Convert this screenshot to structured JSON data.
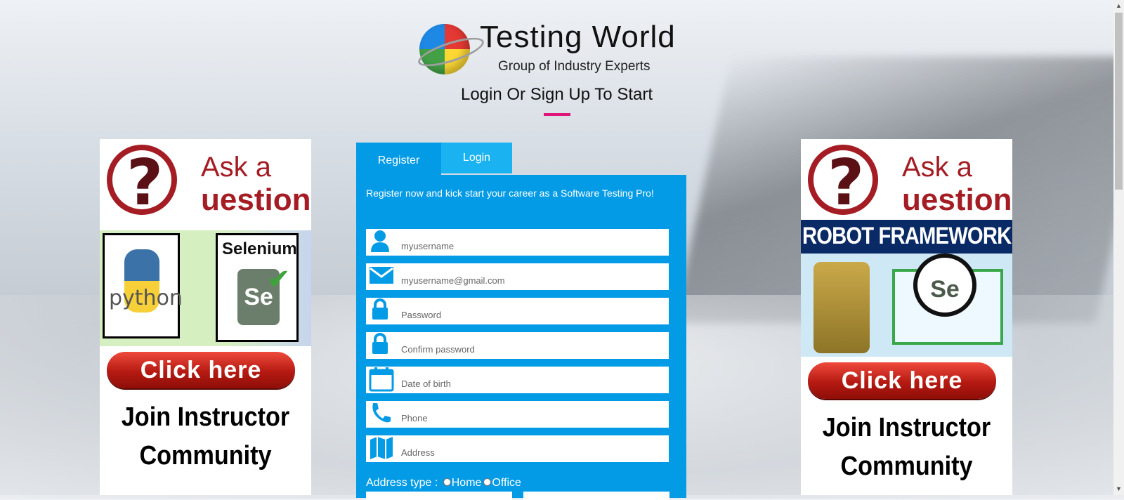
{
  "brand": {
    "title": "Testing World",
    "subtitle": "Group of Industry Experts"
  },
  "heading": "Login Or Sign Up To Start",
  "tabs": {
    "register": "Register",
    "login": "Login"
  },
  "form": {
    "intro": "Register now and kick start your career as a Software Testing Pro!",
    "fields": [
      {
        "icon": "user-icon",
        "placeholder": "myusername"
      },
      {
        "icon": "envelope-icon",
        "placeholder": "myusername@gmail.com"
      },
      {
        "icon": "lock-icon",
        "placeholder": "Password"
      },
      {
        "icon": "lock-icon",
        "placeholder": "Confirm password"
      },
      {
        "icon": "calendar-icon",
        "placeholder": "Date of birth"
      },
      {
        "icon": "phone-icon",
        "placeholder": "Phone"
      },
      {
        "icon": "map-icon",
        "placeholder": "Address"
      }
    ],
    "address_type_label": "Address type :",
    "address_type_options": [
      "Home",
      "Office"
    ]
  },
  "ads": {
    "left": {
      "ask_line1": "Ask a",
      "ask_line2": "uestion",
      "python": "python",
      "selenium": "Selenium",
      "se": "Se",
      "click": "Click here",
      "join_line1": "Join Instructor",
      "join_line2": "Community"
    },
    "right": {
      "ask_line1": "Ask a",
      "ask_line2": "uestion",
      "robot_title": "ROBOT FRAMEWORK",
      "se": "Se",
      "click": "Click here",
      "join_line1": "Join Instructor",
      "join_line2": "Community"
    }
  },
  "colors": {
    "card": "#039be5",
    "tab_login": "#1ab2f0",
    "accent_line": "#e0157a",
    "button_red": "#b51a12"
  }
}
